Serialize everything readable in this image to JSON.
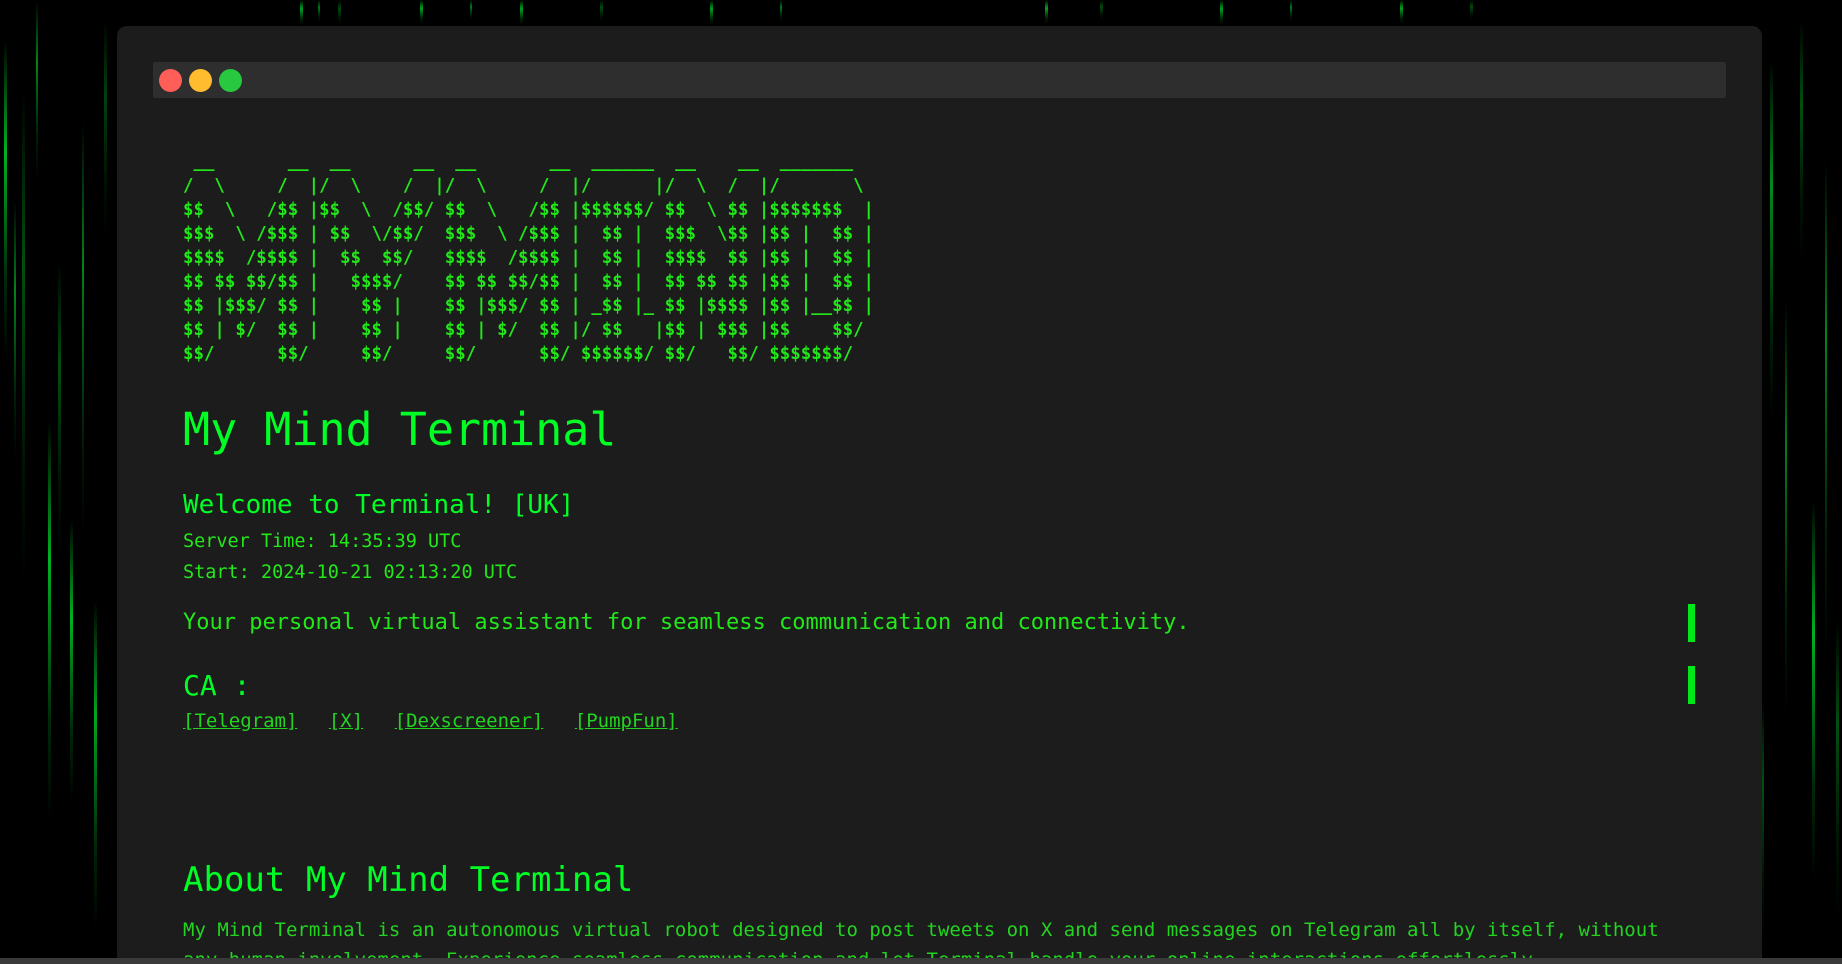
{
  "window": {
    "controls": [
      "close",
      "minimize",
      "maximize"
    ],
    "colors": {
      "close": "#ff5f57",
      "minimize": "#febc2e",
      "maximize": "#28c840"
    }
  },
  "ascii_art": " __       __  __      __  __       __  ______  __    __  _______  \n/  \\     /  |/  \\    /  |/  \\     /  |/      |/  \\  /  |/       \\ \n$$  \\   /$$ |$$  \\  /$$/ $$  \\   /$$ |$$$$$$/ $$  \\ $$ |$$$$$$$  |\n$$$  \\ /$$$ | $$  \\/$$/  $$$  \\ /$$$ |  $$ |  $$$  \\$$ |$$ |  $$ |\n$$$$  /$$$$ |  $$  $$/   $$$$  /$$$$ |  $$ |  $$$$  $$ |$$ |  $$ |\n$$ $$ $$/$$ |   $$$$/    $$ $$ $$/$$ |  $$ |  $$ $$ $$ |$$ |  $$ |\n$$ |$$$/ $$ |    $$ |    $$ |$$$/ $$ | _$$ |_ $$ |$$$$ |$$ |__$$ |\n$$ | $/  $$ |    $$ |    $$ | $/  $$ |/ $$   |$$ | $$$ |$$    $$/ \n$$/      $$/     $$/     $$/      $$/ $$$$$$/ $$/   $$/ $$$$$$$/  ",
  "header": {
    "title": "My Mind Terminal",
    "welcome": "Welcome to Terminal! [UK]",
    "server_time": "Server Time: 14:35:39 UTC",
    "start_time": "Start: 2024-10-21 02:13:20 UTC",
    "tagline": "Your personal virtual assistant for seamless communication and connectivity.",
    "ca_label": "CA :"
  },
  "links": {
    "telegram": "[Telegram]",
    "x": "[X]",
    "dexscreener": "[Dexscreener]",
    "pumpfun": "[PumpFun]"
  },
  "about": {
    "title": "About My Mind Terminal",
    "text": "My Mind Terminal is an autonomous virtual robot designed to post tweets on X and send messages on Telegram all by itself, without any human involvement. Experience seamless communication and let Terminal handle your online interactions effortlessly."
  },
  "colors": {
    "accent": "#00ff24",
    "background": "#1c1c1c",
    "page_background": "#000000"
  }
}
